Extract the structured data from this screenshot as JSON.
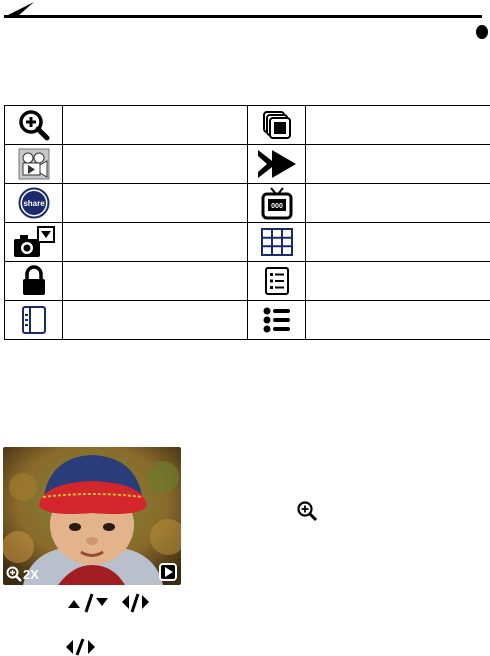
{
  "header": {
    "decoration": "header-rule-with-pen-stroke-and-dot"
  },
  "icon_table": {
    "rows": [
      {
        "left_icon": "magnify-icon",
        "left_text": "",
        "right_icon": "multi-image-icon",
        "right_text": ""
      },
      {
        "left_icon": "video-play-icon",
        "left_text": "",
        "right_icon": "fast-forward-icon",
        "right_text": ""
      },
      {
        "left_icon": "share-icon",
        "left_text": "",
        "right_icon": "tv-slideshow-icon",
        "right_text": ""
      },
      {
        "left_icon": "camera-dropdown-icon",
        "left_text": "",
        "right_icon": "grid-thumbnails-icon",
        "right_text": ""
      },
      {
        "left_icon": "lock-icon",
        "left_text": "",
        "right_icon": "info-list-icon",
        "right_text": ""
      },
      {
        "left_icon": "picture-info-icon",
        "left_text": "",
        "right_icon": "bullet-list-icon",
        "right_text": ""
      }
    ]
  },
  "photo_overlay": {
    "zoom_label": "2X"
  }
}
